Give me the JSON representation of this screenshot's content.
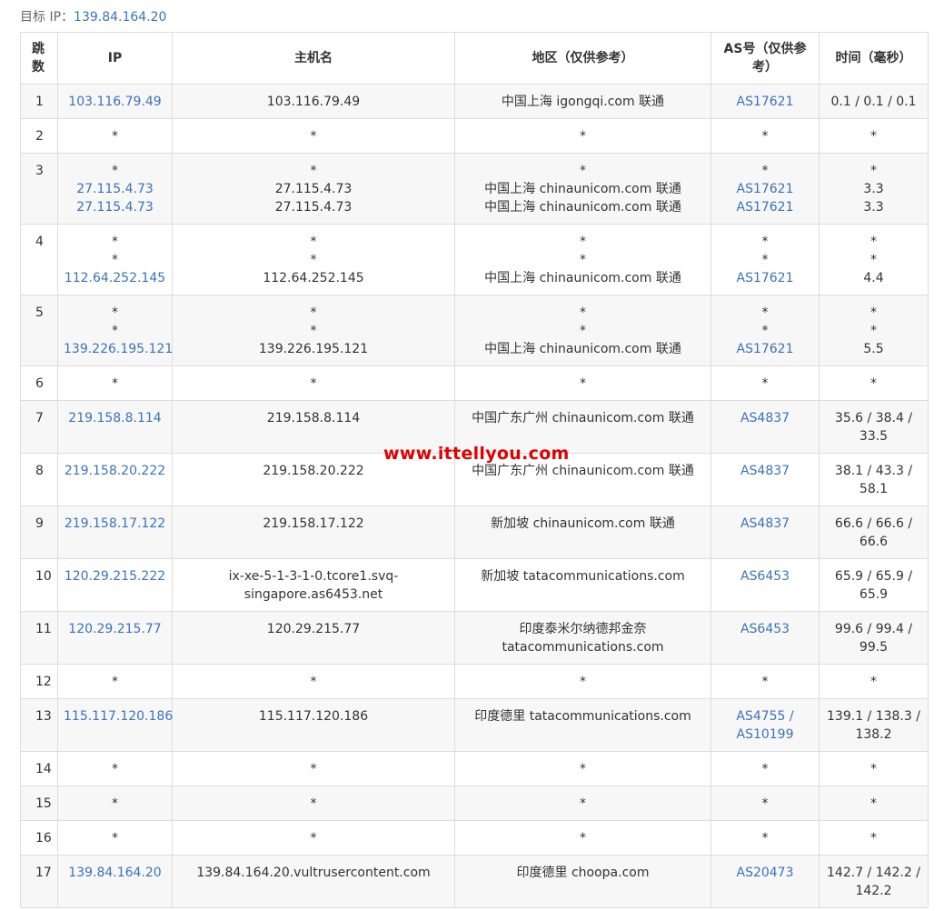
{
  "target": {
    "label": "目标 IP：",
    "ip": "139.84.164.20"
  },
  "headers": {
    "hop": "跳数",
    "ip": "IP",
    "host": "主机名",
    "region": "地区（仅供参考）",
    "as": "AS号（仅供参考）",
    "time": "时间（毫秒）"
  },
  "watermark": "www.ittellyou.com",
  "rows": [
    {
      "hop": "1",
      "ip": [
        "103.116.79.49"
      ],
      "host": [
        "103.116.79.49"
      ],
      "region": [
        "中国上海 igongqi.com 联通"
      ],
      "as": [
        "AS17621"
      ],
      "time": [
        "0.1 / 0.1 / 0.1"
      ]
    },
    {
      "hop": "2",
      "ip": [
        "*"
      ],
      "host": [
        "*"
      ],
      "region": [
        "*"
      ],
      "as": [
        "*"
      ],
      "time": [
        "*"
      ]
    },
    {
      "hop": "3",
      "ip": [
        "*",
        "27.115.4.73",
        "27.115.4.73"
      ],
      "host": [
        "*",
        "27.115.4.73",
        "27.115.4.73"
      ],
      "region": [
        "*",
        "中国上海 chinaunicom.com 联通",
        "中国上海 chinaunicom.com 联通"
      ],
      "as": [
        "*",
        "AS17621",
        "AS17621"
      ],
      "time": [
        "*",
        "3.3",
        "3.3"
      ]
    },
    {
      "hop": "4",
      "ip": [
        "*",
        "*",
        "112.64.252.145"
      ],
      "host": [
        "*",
        "*",
        "112.64.252.145"
      ],
      "region": [
        "*",
        "*",
        "中国上海 chinaunicom.com 联通"
      ],
      "as": [
        "*",
        "*",
        "AS17621"
      ],
      "time": [
        "*",
        "*",
        "4.4"
      ]
    },
    {
      "hop": "5",
      "ip": [
        "*",
        "*",
        "139.226.195.121"
      ],
      "host": [
        "*",
        "*",
        "139.226.195.121"
      ],
      "region": [
        "*",
        "*",
        "中国上海 chinaunicom.com 联通"
      ],
      "as": [
        "*",
        "*",
        "AS17621"
      ],
      "time": [
        "*",
        "*",
        "5.5"
      ]
    },
    {
      "hop": "6",
      "ip": [
        "*"
      ],
      "host": [
        "*"
      ],
      "region": [
        "*"
      ],
      "as": [
        "*"
      ],
      "time": [
        "*"
      ]
    },
    {
      "hop": "7",
      "ip": [
        "219.158.8.114"
      ],
      "host": [
        "219.158.8.114"
      ],
      "region": [
        "中国广东广州 chinaunicom.com 联通"
      ],
      "as": [
        "AS4837"
      ],
      "time": [
        "35.6 / 38.4 /",
        "33.5"
      ]
    },
    {
      "hop": "8",
      "ip": [
        "219.158.20.222"
      ],
      "host": [
        "219.158.20.222"
      ],
      "region": [
        "中国广东广州 chinaunicom.com 联通"
      ],
      "as": [
        "AS4837"
      ],
      "time": [
        "38.1 / 43.3 /",
        "58.1"
      ]
    },
    {
      "hop": "9",
      "ip": [
        "219.158.17.122"
      ],
      "host": [
        "219.158.17.122"
      ],
      "region": [
        "新加坡 chinaunicom.com 联通"
      ],
      "as": [
        "AS4837"
      ],
      "time": [
        "66.6 / 66.6 /",
        "66.6"
      ]
    },
    {
      "hop": "10",
      "ip": [
        "120.29.215.222"
      ],
      "host": [
        "ix-xe-5-1-3-1-0.tcore1.svq-",
        "singapore.as6453.net"
      ],
      "region": [
        "新加坡 tatacommunications.com"
      ],
      "as": [
        "AS6453"
      ],
      "time": [
        "65.9 / 65.9 /",
        "65.9"
      ]
    },
    {
      "hop": "11",
      "ip": [
        "120.29.215.77"
      ],
      "host": [
        "120.29.215.77"
      ],
      "region": [
        "印度泰米尔纳德邦金奈",
        "tatacommunications.com"
      ],
      "as": [
        "AS6453"
      ],
      "time": [
        "99.6 / 99.4 /",
        "99.5"
      ]
    },
    {
      "hop": "12",
      "ip": [
        "*"
      ],
      "host": [
        "*"
      ],
      "region": [
        "*"
      ],
      "as": [
        "*"
      ],
      "time": [
        "*"
      ]
    },
    {
      "hop": "13",
      "ip": [
        "115.117.120.186"
      ],
      "host": [
        "115.117.120.186"
      ],
      "region": [
        "印度德里 tatacommunications.com"
      ],
      "as": [
        "AS4755 /",
        "AS10199"
      ],
      "time": [
        "139.1 / 138.3 /",
        "138.2"
      ]
    },
    {
      "hop": "14",
      "ip": [
        "*"
      ],
      "host": [
        "*"
      ],
      "region": [
        "*"
      ],
      "as": [
        "*"
      ],
      "time": [
        "*"
      ]
    },
    {
      "hop": "15",
      "ip": [
        "*"
      ],
      "host": [
        "*"
      ],
      "region": [
        "*"
      ],
      "as": [
        "*"
      ],
      "time": [
        "*"
      ]
    },
    {
      "hop": "16",
      "ip": [
        "*"
      ],
      "host": [
        "*"
      ],
      "region": [
        "*"
      ],
      "as": [
        "*"
      ],
      "time": [
        "*"
      ]
    },
    {
      "hop": "17",
      "ip": [
        "139.84.164.20"
      ],
      "host": [
        "139.84.164.20.vultrusercontent.com"
      ],
      "region": [
        "印度德里 choopa.com"
      ],
      "as": [
        "AS20473"
      ],
      "time": [
        "142.7 / 142.2 /",
        "142.2"
      ]
    }
  ],
  "colors": {
    "link": "#3b73b9",
    "watermark": "#e00000",
    "zebra": "#f7f7f7",
    "border": "#dddddd"
  }
}
